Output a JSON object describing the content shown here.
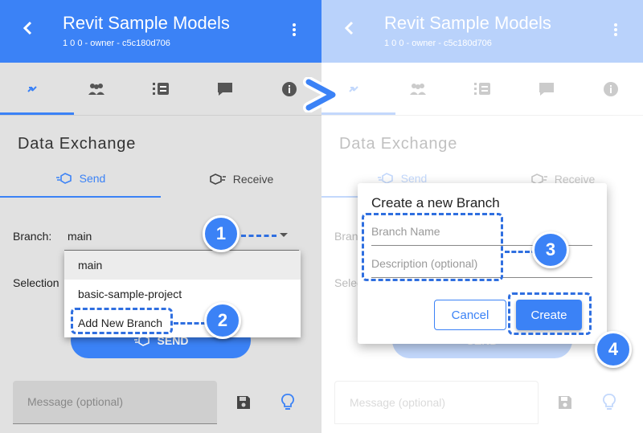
{
  "header": {
    "title": "Revit Sample Models",
    "meta": "1  0  0 - owner - c5c180d706",
    "back_icon": "chevron-left-icon",
    "menu_icon": "more-vert-icon"
  },
  "tabs": [
    "sync-icon",
    "people-icon",
    "list-icon",
    "chat-icon",
    "info-icon"
  ],
  "section": {
    "title": "Data Exchange",
    "send_label": "Send",
    "receive_label": "Receive"
  },
  "form": {
    "branch_label": "Branch:",
    "branch_value": "main",
    "selection_label": "Selection",
    "send_button": "SEND",
    "message_placeholder": "Message (optional)"
  },
  "dropdown": {
    "items": [
      "main",
      "basic-sample-project",
      "Add New Branch"
    ],
    "selected": "main"
  },
  "dialog": {
    "title": "Create a new Branch",
    "name_placeholder": "Branch Name",
    "description_placeholder": "Description (optional)",
    "cancel_label": "Cancel",
    "create_label": "Create"
  },
  "steps": [
    "1",
    "2",
    "3",
    "4"
  ],
  "colors": {
    "accent": "#3b82f6",
    "annotation": "#2f6fe0"
  }
}
